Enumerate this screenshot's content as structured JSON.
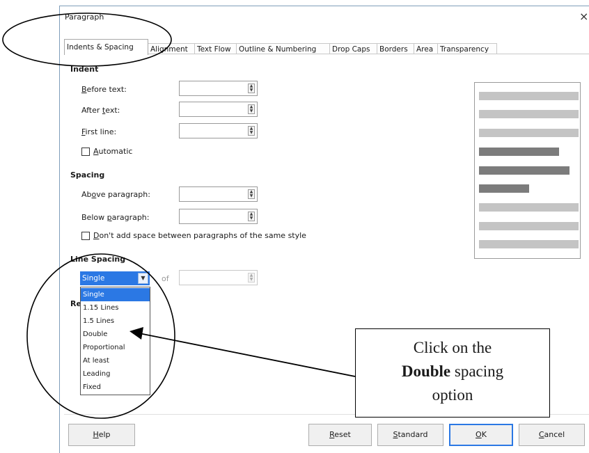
{
  "dialog": {
    "title": "Paragraph",
    "close_glyph": "×"
  },
  "tabs": [
    {
      "label": "Indents & Spacing",
      "active": true
    },
    {
      "label": "Alignment"
    },
    {
      "label": "Text Flow"
    },
    {
      "label": "Outline & Numbering"
    },
    {
      "label": "Drop Caps"
    },
    {
      "label": "Borders"
    },
    {
      "label": "Area"
    },
    {
      "label": "Transparency"
    }
  ],
  "indent": {
    "title": "Indent",
    "before_text": {
      "pre": "",
      "u": "B",
      "post": "efore text:"
    },
    "after_text": {
      "pre": "After ",
      "u": "t",
      "post": "ext:"
    },
    "first_line": {
      "pre": "",
      "u": "F",
      "post": "irst line:"
    },
    "automatic": {
      "pre": "",
      "u": "A",
      "post": "utomatic",
      "checked": false
    }
  },
  "spacing": {
    "title": "Spacing",
    "above": {
      "pre": "Ab",
      "u": "o",
      "post": "ve paragraph:"
    },
    "below": {
      "pre": "Below ",
      "u": "p",
      "post": "aragraph:"
    },
    "dont_add": {
      "pre": "",
      "u": "D",
      "post": "on't add space between paragraphs of the same style",
      "checked": false
    }
  },
  "line_spacing": {
    "title": "Line Spacing",
    "selected": "Single",
    "of_label_partial": "of",
    "options": [
      "Single",
      "1.15 Lines",
      "1.5 Lines",
      "Double",
      "Proportional",
      "At least",
      "Leading",
      "Fixed"
    ],
    "register_partial": "Re"
  },
  "buttons": {
    "help": {
      "pre": "",
      "u": "H",
      "post": "elp"
    },
    "reset": {
      "pre": "",
      "u": "R",
      "post": "eset"
    },
    "standard": {
      "pre": "",
      "u": "S",
      "post": "tandard"
    },
    "ok": {
      "pre": "",
      "u": "O",
      "post": "K"
    },
    "cancel": {
      "pre": "",
      "u": "C",
      "post": "ancel"
    }
  },
  "callout": {
    "line1": "Click on the",
    "bold": "Double",
    "line2_rest": " spacing",
    "line3": "option"
  },
  "colors": {
    "accent": "#2b78e4",
    "annotation": "#000000"
  }
}
